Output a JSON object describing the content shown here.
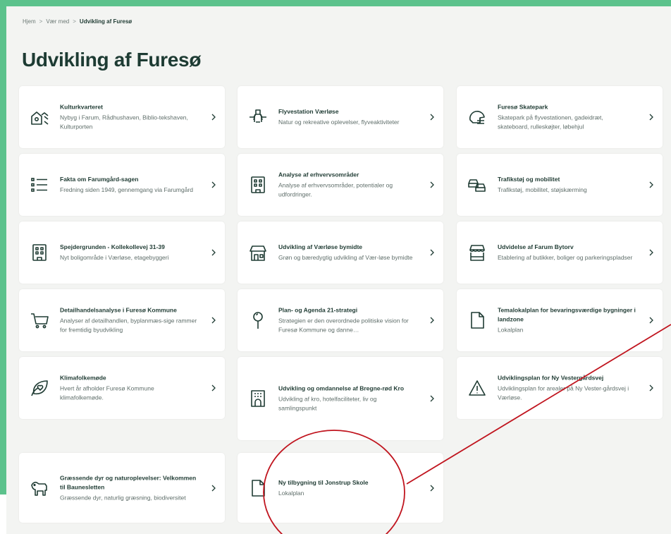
{
  "breadcrumb": {
    "items": [
      "Hjem",
      "Vær med"
    ],
    "separator": ">",
    "current": "Udvikling af Furesø"
  },
  "page_title": "Udvikling af Furesø",
  "cards": [
    {
      "title": "Kulturkvarteret",
      "desc": "Nybyg i Farum, Rådhushaven, Biblio-tekshaven, Kulturporten",
      "icon": "house-building-icon"
    },
    {
      "title": "Flyvestation Værløse",
      "desc": "Natur og rekreative oplevelser, flyveaktiviteter",
      "icon": "airplane-icon"
    },
    {
      "title": "Furesø Skatepark",
      "desc": "Skatepark på flyvestationen, gadeidræt, skateboard, rulleskøjter, løbehjul",
      "icon": "helmet-icon"
    },
    {
      "title": "Fakta om Farumgård-sagen",
      "desc": "Fredning siden 1949, gennemgang via Farumgård",
      "icon": "list-icon"
    },
    {
      "title": "Analyse af erhvervsområder",
      "desc": "Analyse af erhvervsområder, potentialer og udfordringer.",
      "icon": "building-icon"
    },
    {
      "title": "Trafikstøj og mobilitet",
      "desc": "Trafikstøj, mobilitet, støjskærming",
      "icon": "cars-icon"
    },
    {
      "title": "Spejdergrunden - Kollekollevej 31-39",
      "desc": "Nyt boligområde i Værløse, etagebyggeri",
      "icon": "building-icon"
    },
    {
      "title": "Udvikling af Værløse bymidte",
      "desc": "Grøn og bæredygtig udvikling af Vær-løse bymidte",
      "icon": "shop-icon"
    },
    {
      "title": "Udvidelse af Farum Bytorv",
      "desc": "Etablering af butikker, boliger og parkeringspladser",
      "icon": "store-icon"
    },
    {
      "title": "Detailhandelsanalyse i Furesø Kommune",
      "desc": "Analyser af detailhandlen, byplanmæs-sige rammer for fremtidig byudvikling",
      "icon": "cart-icon"
    },
    {
      "title": "Plan- og Agenda 21-strategi",
      "desc": "Strategien er den overordnede politiske vision for Furesø Kommune og danne…",
      "icon": "pin-icon"
    },
    {
      "title": "Temalokalplan for bevaringsværdige bygninger i landzone",
      "desc": "Lokalplan",
      "icon": "document-icon"
    },
    {
      "title": "Klimafolkemøde",
      "desc": "Hvert år afholder Furesø Kommune klimafolkemøde.",
      "icon": "leaf-heart-icon"
    },
    {
      "title": "Udvikling og omdannelse af Bregne-rød Kro",
      "desc": "Udvikling af kro, hotelfaciliteter, liv og samlingspunkt",
      "icon": "hotel-icon"
    },
    {
      "title": "Udviklingsplan for Ny Vestergårdsvej",
      "desc": "Udviklingsplan for arealer på Ny Vester-gårdsvej i Værløse.",
      "icon": "warning-icon"
    },
    {
      "title": "Græssende dyr og naturoplevelser: Velkommen til Baunesletten",
      "desc": "Græssende dyr, naturlig græsning, biodiversitet",
      "icon": "animal-icon"
    },
    {
      "title": "Ny tilbygning til Jonstrup Skole",
      "desc": "Lokalplan",
      "icon": "document-icon"
    }
  ],
  "colors": {
    "frame": "#5cc28c",
    "page": "#f3f4f2",
    "card": "#ffffff",
    "title": "#1d3b33",
    "annotation": "#c0141e"
  }
}
